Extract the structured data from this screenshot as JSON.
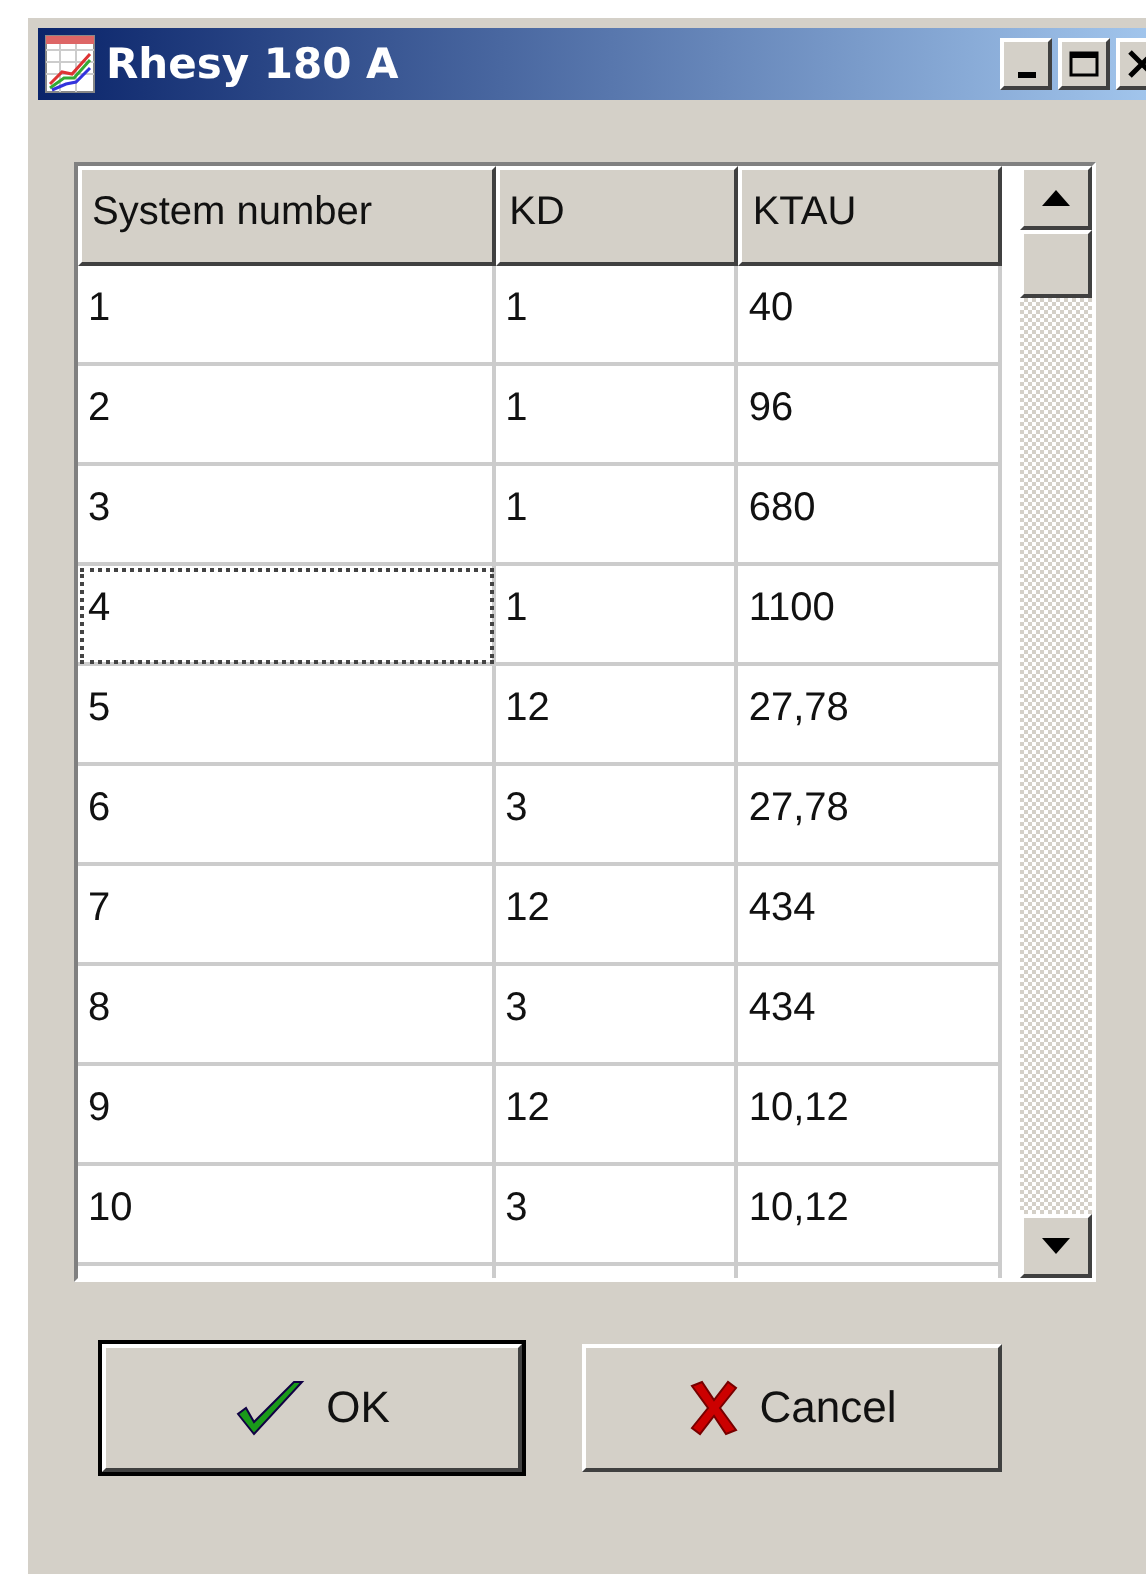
{
  "window": {
    "title": "Rhesy 180 A"
  },
  "table": {
    "columns": [
      "System number",
      "KD",
      "KTAU"
    ],
    "rows": [
      {
        "cells": [
          "1",
          "1",
          "40"
        ],
        "focused": false
      },
      {
        "cells": [
          "2",
          "1",
          "96"
        ],
        "focused": false
      },
      {
        "cells": [
          "3",
          "1",
          "680"
        ],
        "focused": false
      },
      {
        "cells": [
          "4",
          "1",
          "1100"
        ],
        "focused": true
      },
      {
        "cells": [
          "5",
          "12",
          "27,78"
        ],
        "focused": false
      },
      {
        "cells": [
          "6",
          "3",
          "27,78"
        ],
        "focused": false
      },
      {
        "cells": [
          "7",
          "12",
          "434"
        ],
        "focused": false
      },
      {
        "cells": [
          "8",
          "3",
          "434"
        ],
        "focused": false
      },
      {
        "cells": [
          "9",
          "12",
          "10,12"
        ],
        "focused": false
      },
      {
        "cells": [
          "10",
          "3",
          "10,12"
        ],
        "focused": false
      }
    ]
  },
  "buttons": [
    {
      "kind": "ok",
      "label": "OK",
      "default": true
    },
    {
      "kind": "cancel",
      "label": "Cancel",
      "default": false
    }
  ]
}
